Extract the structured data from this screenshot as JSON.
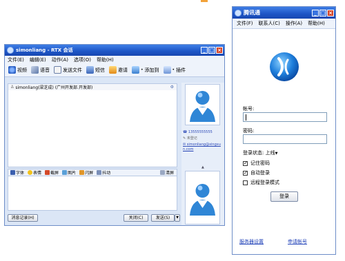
{
  "colors": {
    "accent": "#f2a23a",
    "titlebar": "#1d55c6",
    "panel": "#dbe6f6",
    "link": "#1d3fb7"
  },
  "chat_window": {
    "title": "simonliang - RTX 会话",
    "window_buttons": [
      "_",
      "□",
      "×"
    ],
    "menu": [
      "文件(E)",
      "编辑(E)",
      "动作(A)",
      "选项(O)",
      "帮助(H)"
    ],
    "toolbar": [
      {
        "label": "视频",
        "icon": "video-icon"
      },
      {
        "label": "语音",
        "icon": "voice-icon"
      },
      {
        "label": "发送文件",
        "icon": "send-file-icon"
      },
      {
        "label": "短信",
        "icon": "sms-icon"
      },
      {
        "label": "邀请",
        "icon": "invite-icon"
      },
      {
        "label": "添加到",
        "icon": "add-to-icon"
      },
      {
        "label": "插件",
        "icon": "plugin-icon"
      }
    ],
    "conversation_header": "simonliang(梁芝成) (广州开发部.开发部)",
    "format_bar": [
      "字体",
      "表情",
      "截屏",
      "图片",
      "闪屏",
      "抖动",
      "清屏"
    ],
    "buttons": {
      "history": "消息记录(H)",
      "close": "关闭(C)",
      "send": "发送(S)",
      "send_arrow": "▼"
    },
    "contact_info": {
      "phone": "13555555555",
      "note": "未登记",
      "email": "simonliang@xingxun.com"
    }
  },
  "login_window": {
    "title": "腾讯通",
    "window_buttons": [
      "_",
      "□",
      "×"
    ],
    "menu": [
      "文件(F)",
      "联系人(C)",
      "操作(A)",
      "帮助(H)"
    ],
    "account_label": "帐号:",
    "account_value": "",
    "password_label": "密码:",
    "status_label": "登录状态:",
    "status_value": "上线",
    "remember_password": {
      "label": "记住密码",
      "checked": true
    },
    "auto_login": {
      "label": "自动登录",
      "checked": true
    },
    "remote_login": {
      "label": "远程登录模式",
      "checked": false
    },
    "login_button": "登录",
    "server_settings_link": "服务器设置",
    "apply_account_link": "申请帐号"
  }
}
